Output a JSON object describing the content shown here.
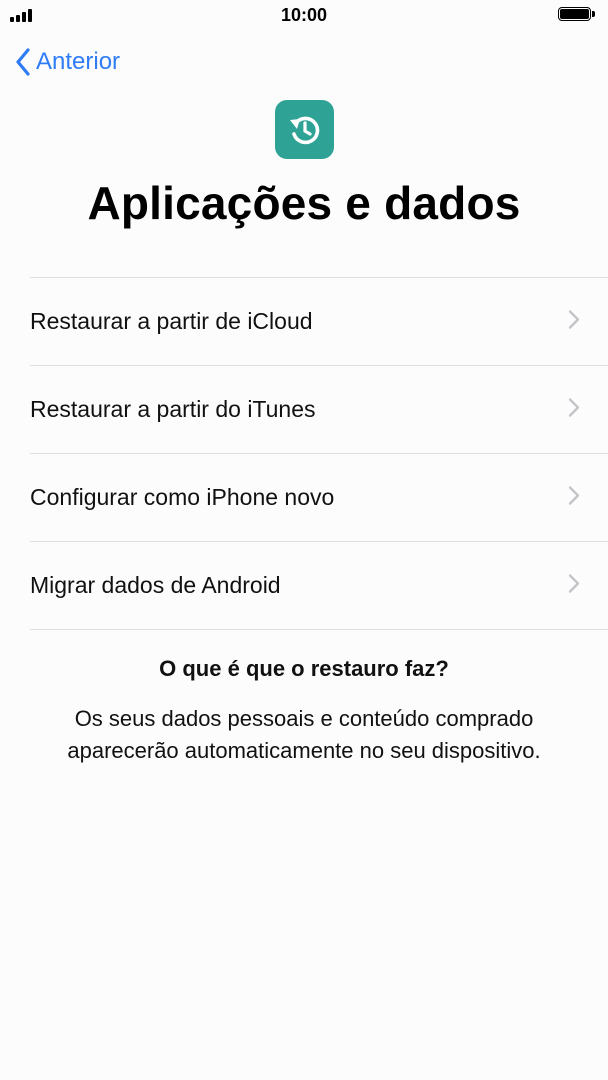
{
  "status_bar": {
    "time": "10:00",
    "signal_icon": "cellular-signal-icon",
    "battery_icon": "battery-full-icon"
  },
  "nav": {
    "back_label": "Anterior",
    "back_icon": "chevron-left-icon",
    "accent_color": "#2f7cf6"
  },
  "header": {
    "icon": "restore-backup-icon",
    "icon_color": "#2ea295",
    "title": "Aplicações e dados"
  },
  "options": [
    {
      "label": "Restaurar a partir de iCloud"
    },
    {
      "label": "Restaurar a partir do iTunes"
    },
    {
      "label": "Configurar como iPhone novo"
    },
    {
      "label": "Migrar dados de Android"
    }
  ],
  "info": {
    "heading": "O que é que o restauro faz?",
    "body_line1": "Os seus dados pessoais e conteúdo comprado",
    "body_line2": "aparecerão automaticamente no seu dispositivo."
  }
}
